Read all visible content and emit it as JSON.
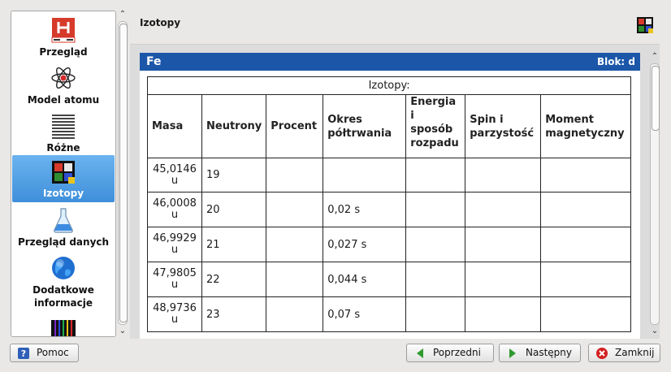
{
  "sidebar": {
    "items": [
      {
        "label": "Przegląd",
        "icon": "hydrogen-symbol-icon"
      },
      {
        "label": "Model atomu",
        "icon": "atom-model-icon"
      },
      {
        "label": "Różne",
        "icon": "misc-lines-icon"
      },
      {
        "label": "Izotopy",
        "icon": "isotopes-grid-icon",
        "selected": true
      },
      {
        "label": "Przegląd danych",
        "icon": "flask-icon"
      },
      {
        "label": "Dodatkowe",
        "label2": "informacje",
        "icon": "globe-icon"
      },
      {
        "label": "",
        "icon": "spectrum-icon"
      }
    ]
  },
  "header": {
    "title": "Izotopy",
    "icon": "isotopes-grid-icon"
  },
  "panel": {
    "symbol": "Fe",
    "block": "Blok: d"
  },
  "table": {
    "caption": "Izotopy:",
    "headers": {
      "mass": "Masa",
      "neutrons": "Neutrony",
      "percent": "Procent",
      "halflife": [
        "Okres",
        "półtrwania"
      ],
      "energy": [
        "Energia",
        "i",
        "sposób",
        "rozpadu"
      ],
      "spin": [
        "Spin i",
        "parzystość"
      ],
      "moment": [
        "Moment",
        "magnetyczny"
      ]
    },
    "rows": [
      {
        "mass": "45,0146",
        "unit": "u",
        "neutrons": "19",
        "percent": "",
        "halflife": "",
        "energy": "",
        "spin": "",
        "moment": ""
      },
      {
        "mass": "46,0008",
        "unit": "u",
        "neutrons": "20",
        "percent": "",
        "halflife": "0,02 s",
        "energy": "",
        "spin": "",
        "moment": ""
      },
      {
        "mass": "46,9929",
        "unit": "u",
        "neutrons": "21",
        "percent": "",
        "halflife": "0,027 s",
        "energy": "",
        "spin": "",
        "moment": ""
      },
      {
        "mass": "47,9805",
        "unit": "u",
        "neutrons": "22",
        "percent": "",
        "halflife": "0,044 s",
        "energy": "",
        "spin": "",
        "moment": ""
      },
      {
        "mass": "48,9736",
        "unit": "u",
        "neutrons": "23",
        "percent": "",
        "halflife": "0,07 s",
        "energy": "",
        "spin": "",
        "moment": ""
      }
    ]
  },
  "buttons": {
    "help": "Pomoc",
    "prev": "Poprzedni",
    "next": "Następny",
    "close": "Zamknij"
  },
  "colors": {
    "panel_header": "#1b56a9",
    "selection": "#4a97de",
    "next_arrow": "#2e9a2e",
    "close_icon": "#d42020"
  }
}
